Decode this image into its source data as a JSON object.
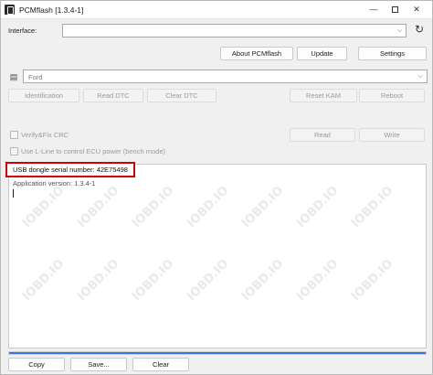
{
  "window": {
    "title": "PCMflash [1.3.4-1]",
    "min_glyph": "—",
    "close_glyph": "✕"
  },
  "interface": {
    "label": "Interface:",
    "value": ""
  },
  "toolbar": {
    "about": "About PCMflash",
    "update": "Update",
    "settings": "Settings"
  },
  "module": {
    "value": "Ford"
  },
  "actions": {
    "identification": "Identification",
    "read_dtc": "Read DTC",
    "clear_dtc": "Clear DTC",
    "reset_kam": "Reset KAM",
    "reboot": "Reboot"
  },
  "options": {
    "verify_crc": "Verify&Fix CRC",
    "use_lline": "Use L-Line to control ECU power (bench mode)",
    "read": "Read",
    "write": "Write"
  },
  "log": {
    "highlight": "USB dongle serial number: 42E75498",
    "line2": "Application version: 1.3.4-1"
  },
  "footer": {
    "copy": "Copy",
    "save": "Save...",
    "clear": "Clear"
  },
  "progress": {
    "value": 1.0
  },
  "watermark": {
    "text": "IOBD.IO"
  },
  "icons": {
    "refresh": "refresh-icon",
    "app": "pcmflash-app-icon",
    "module": "module-icon"
  },
  "colors": {
    "highlight_border": "#d00000",
    "progress": "#3a78d8"
  }
}
